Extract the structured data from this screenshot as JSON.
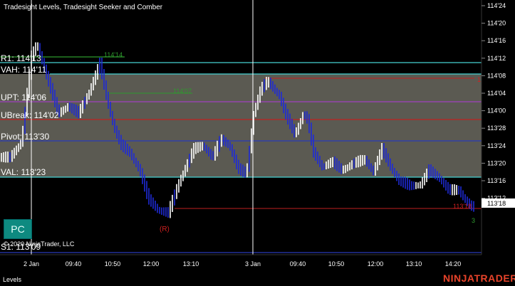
{
  "window": {
    "title": "Tradesight Levels, Tradesight Seeker and Comber"
  },
  "brand": {
    "logo_text": "NINJATRADER",
    "copyright": "© 2020 NinjaTrader, LLC"
  },
  "bottom_bar": {
    "tab_label": "Levels"
  },
  "pc_button": {
    "label": "PC"
  },
  "price_axis": {
    "ticks": [
      "114'24",
      "114'20",
      "114'16",
      "114'12",
      "114'08",
      "114'04",
      "114'00",
      "113'28",
      "113'24",
      "113'20",
      "113'16",
      "113'12"
    ],
    "current_price": "113'18"
  },
  "time_axis": {
    "ticks": [
      "2 Jan",
      "09:40",
      "10:50",
      "12:00",
      "13:10",
      "3 Jan",
      "09:40",
      "10:50",
      "12:00",
      "13:10",
      "14:20"
    ]
  },
  "levels": [
    {
      "label": "R1: 114'13",
      "color": "#2e9a2e"
    },
    {
      "label": "VAH: 114'11",
      "color": "#46d4d4"
    },
    {
      "label": "UPT: 114'06",
      "color": "#a040c0"
    },
    {
      "label": "UBreak: 114'02",
      "color": "#c02020"
    },
    {
      "label": "Pivot: 113'30",
      "color": "#2a3ab8"
    },
    {
      "label": "VAL: 113'23",
      "color": "#46d4d4"
    },
    {
      "label": "S1: 113'09",
      "color": "#2a3ab8"
    }
  ],
  "annotations": {
    "r1_tag": "114'14",
    "mid_tag": "114'07",
    "red_tag": "113'18",
    "r_marker": "(R)",
    "right_mark": "1",
    "lower_green": "3"
  },
  "colors": {
    "value_area": "#5b5a52",
    "up_bar": "#ffffff",
    "down_bar": "#1f2ad8"
  }
}
